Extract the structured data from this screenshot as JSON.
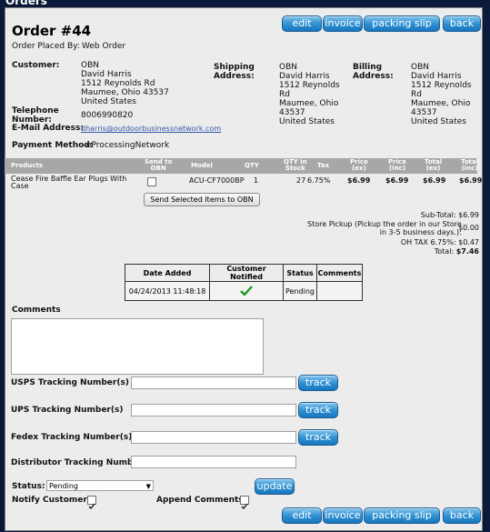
{
  "window": {
    "title": "Orders"
  },
  "toolbar": {
    "edit": "edit",
    "invoice": "invoice",
    "packing_slip": "packing slip",
    "back": "back"
  },
  "order": {
    "title": "Order #44",
    "placed_by_label": "Order Placed By:",
    "placed_by_value": "Web Order",
    "customer_label": "Customer:",
    "customer": [
      "OBN",
      "David Harris",
      "1512 Reynolds Rd",
      "Maumee, Ohio 43537",
      "United States"
    ],
    "shipping_label": [
      "Shipping",
      "Address:"
    ],
    "shipping": [
      "OBN",
      "David Harris",
      "1512 Reynolds",
      "Rd",
      "Maumee, Ohio",
      "43537",
      "United States"
    ],
    "billing_label": [
      "Billing",
      "Address:"
    ],
    "billing": [
      "OBN",
      "David Harris",
      "1512 Reynolds",
      "Rd",
      "Maumee, Ohio",
      "43537",
      "United States"
    ],
    "telephone_label": [
      "Telephone",
      "Number:"
    ],
    "telephone": "8006990820",
    "email_label": "E-Mail Address:",
    "email": "dharris@outdoorbusinessnetwork.com",
    "payment_label": "Payment Method:",
    "payment": "eProcessingNetwork"
  },
  "products_table": {
    "headers": {
      "products": "Products",
      "send_to_obn": [
        "Send to",
        "OBN"
      ],
      "model": "Model",
      "qty": "QTY",
      "qty_in_stock": [
        "QTY in",
        "Stock"
      ],
      "tax": "Tax",
      "price_ex": [
        "Price",
        "(ex)"
      ],
      "price_inc": [
        "Price",
        "(inc)"
      ],
      "total_ex": [
        "Total",
        "(ex)"
      ],
      "total_inc": [
        "Total",
        "(inc)"
      ]
    },
    "row": {
      "name": [
        "Cease Fire Baffle Ear Plugs With",
        "Case"
      ],
      "model": "ACU-CF7000BP",
      "qty": "1",
      "stock": "27",
      "tax": "6.75%",
      "price_ex": "$6.99",
      "price_inc": "$6.99",
      "total_ex": "$6.99",
      "total_inc": "$6.99"
    },
    "send_button": "Send Selected Items to OBN"
  },
  "totals": {
    "subtotal": "Sub-Total: $6.99",
    "pickup_line1": "Store Pickup (Pickup the order in our Store",
    "pickup_line2": "in 3-5 business days.):",
    "pickup_value": "$0.00",
    "tax": "OH TAX 6.75%: $0.47",
    "total_label": "Total:",
    "total_value": "$7.46"
  },
  "history": {
    "headers": [
      "Date Added",
      "Customer Notified",
      "Status",
      "Comments"
    ],
    "date": "04/24/2013 11:48:18",
    "status": "Pending",
    "comments": ""
  },
  "form": {
    "comments_label": "Comments",
    "usps_label": "USPS Tracking Number(s)",
    "ups_label": "UPS Tracking Number(s)",
    "fedex_label": "Fedex Tracking Number(s)",
    "distributor_label": "Distributor Tracking Number",
    "track": "track",
    "status_label": "Status:",
    "status_value": "Pending",
    "update": "update",
    "notify_label": "Notify Customer:",
    "append_label": "Append Comments:"
  },
  "colors": {
    "button_blue": "#2d8fd0",
    "header_grey": "#a7a7a7",
    "check_green": "#1f9a1f"
  },
  "icons": {
    "check": "check-icon",
    "select_arrow": "chevron-down-icon"
  }
}
